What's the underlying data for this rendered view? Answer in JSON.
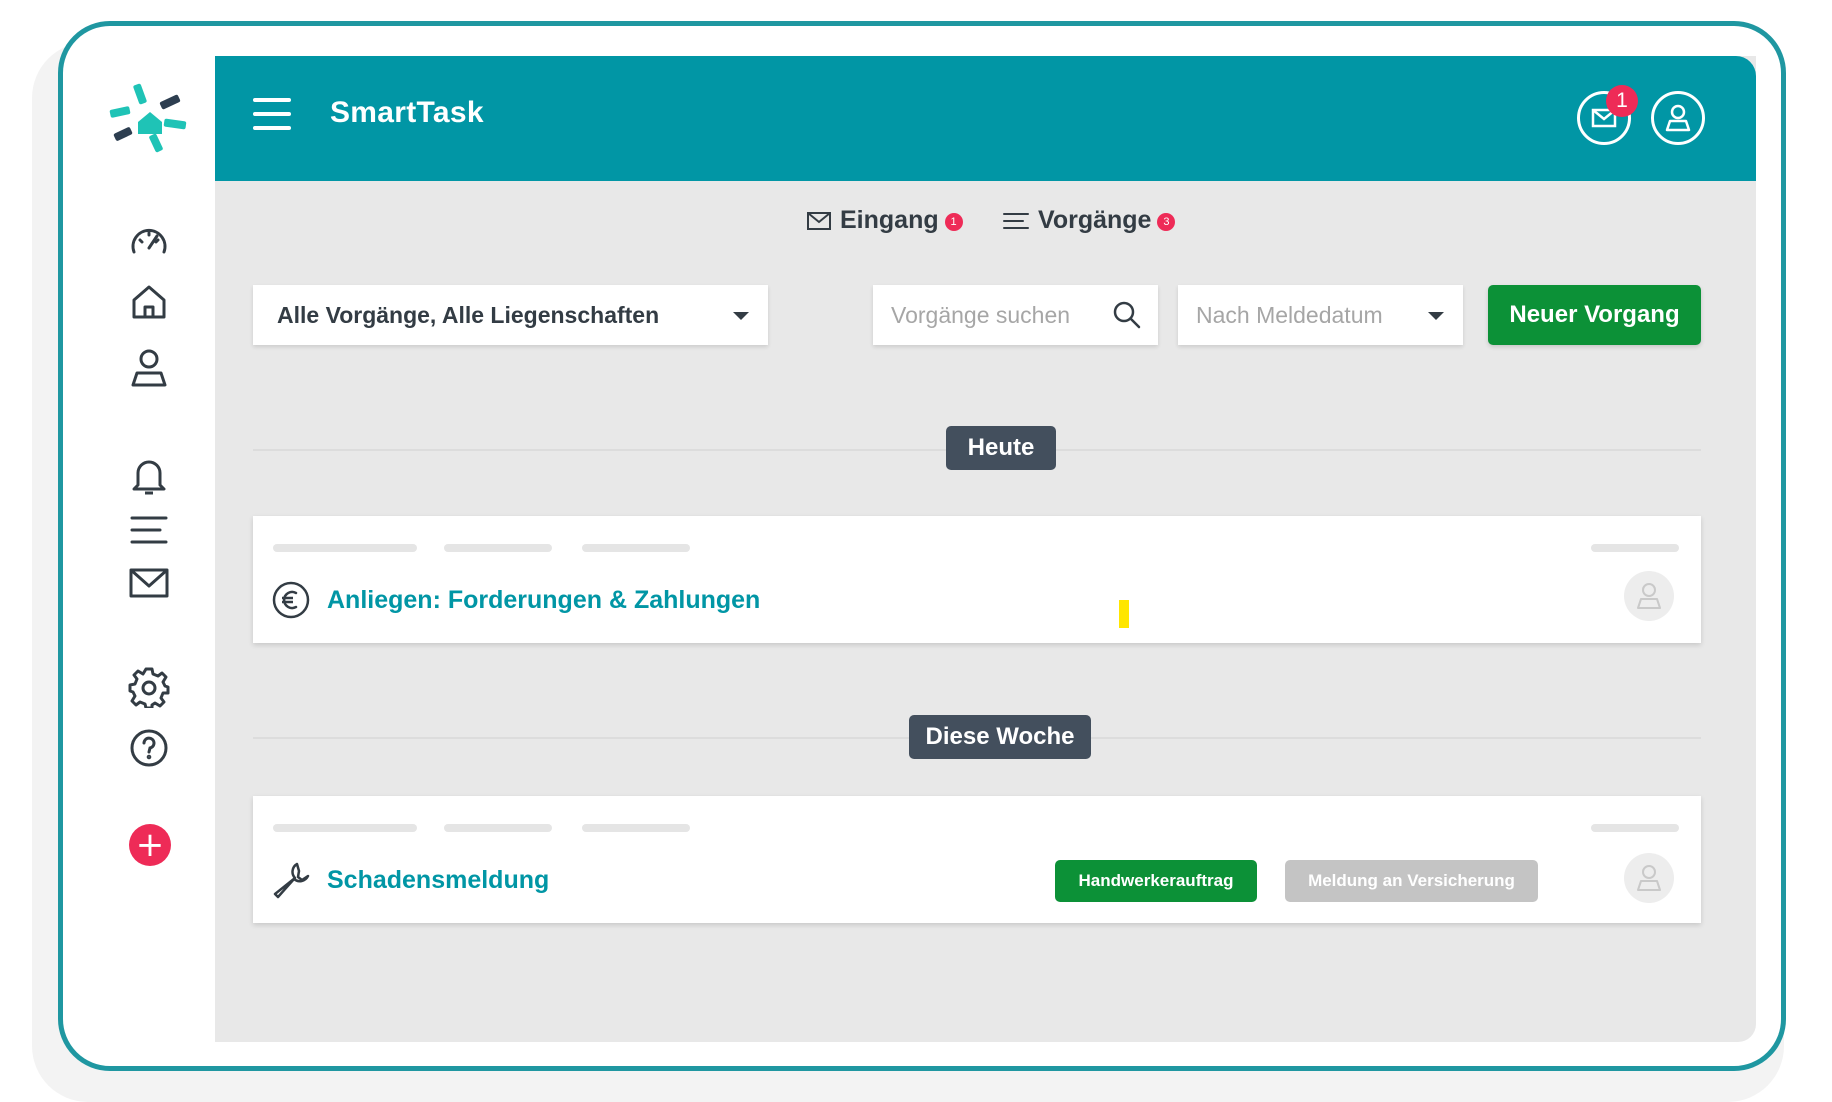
{
  "app": {
    "title": "SmartTask",
    "notification_count": "1"
  },
  "tabs": [
    {
      "label": "Eingang",
      "badge": "1",
      "icon": "mail-icon"
    },
    {
      "label": "Vorgänge",
      "badge": "3",
      "icon": "list-icon"
    }
  ],
  "filter": {
    "selected": "Alle Vorgänge, Alle Liegenschaften"
  },
  "search": {
    "placeholder": "Vorgänge suchen"
  },
  "sort": {
    "selected": "Nach Meldedatum"
  },
  "new_button": {
    "label": "Neuer Vorgang"
  },
  "sections": [
    {
      "label": "Heute",
      "cards": [
        {
          "title": "Anliegen: Forderungen & Zahlungen",
          "icon": "euro-icon"
        }
      ]
    },
    {
      "label": "Diese Woche",
      "cards": [
        {
          "title": "Schadensmeldung",
          "icon": "wrench-icon",
          "chips": [
            "Handwerkerauftrag",
            "Meldung an Versicherung"
          ]
        }
      ]
    }
  ],
  "sidebar": {
    "icons": [
      "dashboard-icon",
      "home-icon",
      "person-icon",
      "bell-icon",
      "list-icon",
      "mail-icon",
      "gear-icon",
      "help-icon",
      "add-icon"
    ]
  },
  "colors": {
    "primary": "#0196a5",
    "accent_green": "#0c9137",
    "badge_red": "#ee2b57",
    "section_label": "#434f5d",
    "chip_disabled": "#c4c4c4"
  }
}
